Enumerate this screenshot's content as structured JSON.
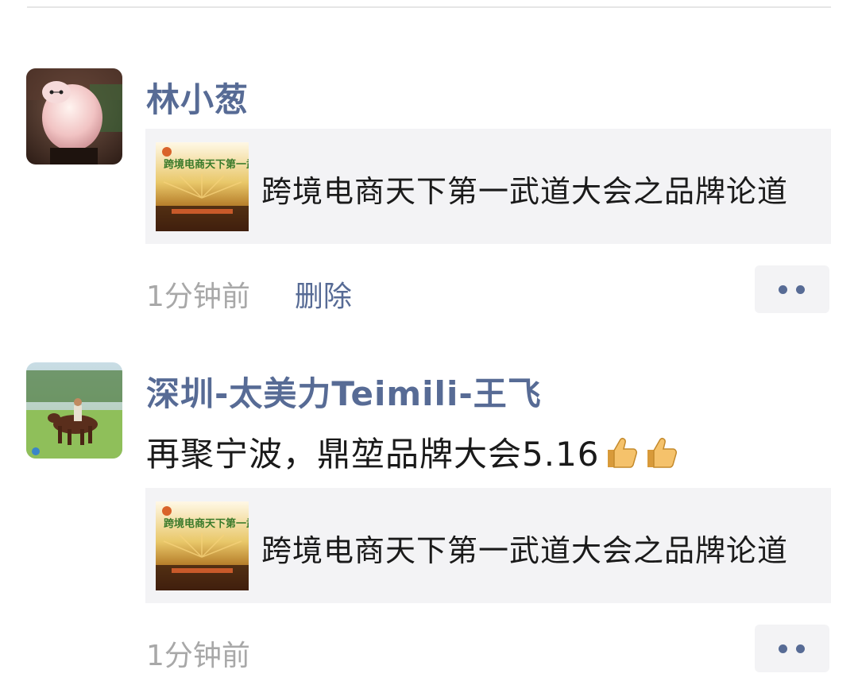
{
  "posts": [
    {
      "author": "林小葱",
      "text": "",
      "link_card": {
        "title": "跨境电商天下第一武道大会之品牌论道",
        "thumb_overlay": "跨境电商天下第一武道"
      },
      "time": "1分钟前",
      "delete_label": "删除",
      "avatar_icon": "big-white-robot-avatar",
      "more_icon": "more-dots-icon"
    },
    {
      "author": "深圳-太美力Teimili-王飞",
      "text": "再聚宁波，鼎堃品牌大会5.16",
      "emoji": [
        "thumbs-up-icon",
        "thumbs-up-icon"
      ],
      "link_card": {
        "title": "跨境电商天下第一武道大会之品牌论道",
        "thumb_overlay": "跨境电商天下第一武道"
      },
      "time": "1分钟前",
      "avatar_icon": "horse-rider-avatar",
      "more_icon": "more-dots-icon"
    }
  ],
  "colors": {
    "name_link": "#576b95",
    "time_gray": "#a8a8a8",
    "card_bg": "#f3f3f5",
    "text": "#1a1a1a"
  }
}
